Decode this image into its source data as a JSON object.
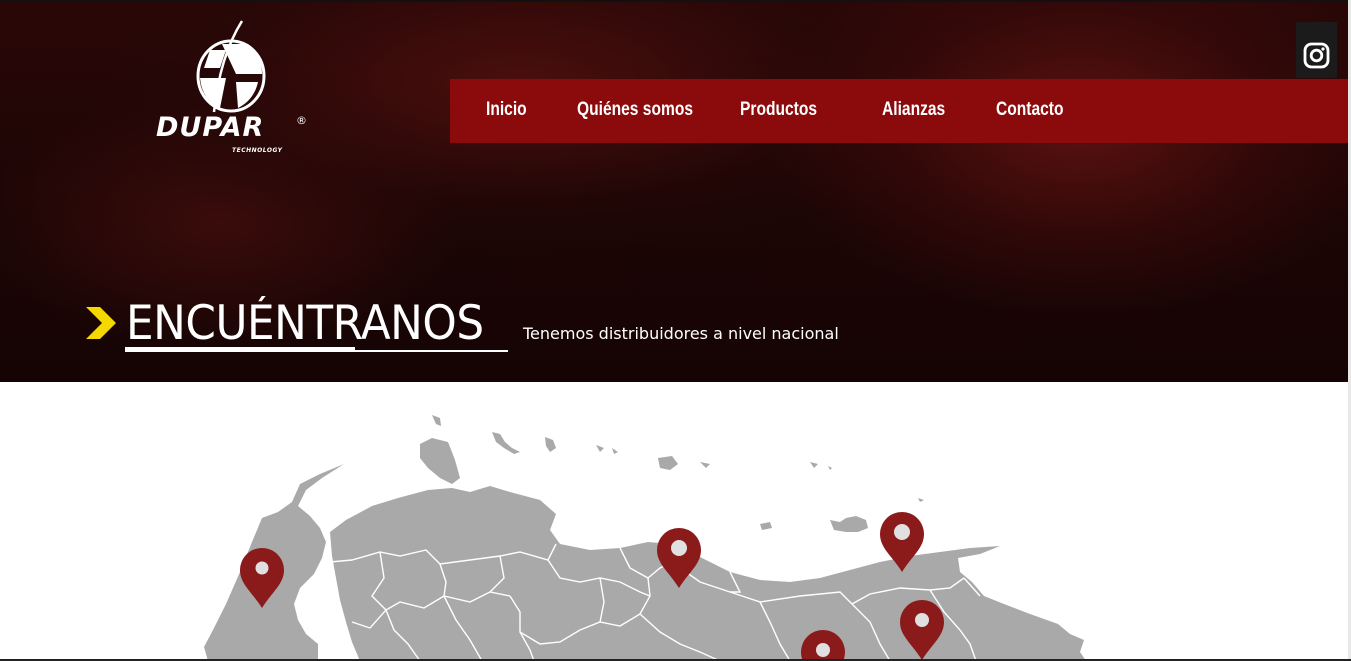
{
  "brand": {
    "name": "DUPAR",
    "registered": "®",
    "tagline": "TECHNOLOGY"
  },
  "nav": {
    "items": [
      {
        "label": "Inicio"
      },
      {
        "label": "Quiénes somos"
      },
      {
        "label": "Productos"
      },
      {
        "label": "Alianzas"
      },
      {
        "label": "Contacto"
      }
    ]
  },
  "social": {
    "icon": "instagram-icon"
  },
  "hero": {
    "title": "ENCUÉNTRANOS",
    "subtitle": "Tenemos distribuidores a nivel nacional"
  },
  "colors": {
    "nav_bg": "#8b0a0c",
    "accent_chevron": "#f5d800",
    "map_land": "#a9a9a9",
    "pin": "#8b1a1a"
  }
}
